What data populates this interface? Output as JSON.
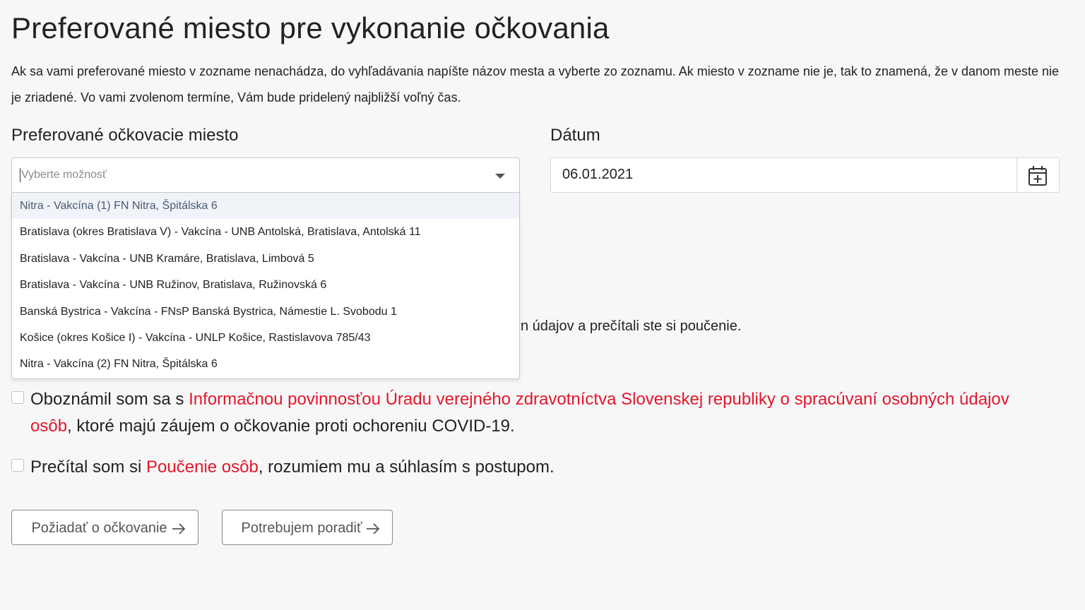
{
  "page": {
    "title": "Preferované miesto pre vykonanie očkovania",
    "intro": "Ak sa vami preferované miesto v zozname nenachádza, do vyhľadávania napíšte názov mesta a vyberte zo zoznamu. Ak miesto v zozname nie je, tak to znamená, že v danom meste nie je zriadené. Vo vami zvolenom termíne, Vám bude pridelený najbližší voľný čas."
  },
  "place": {
    "label": "Preferované očkovacie miesto",
    "placeholder": "Vyberte možnosť",
    "options": [
      "Nitra - Vakcína (1) FN Nitra, Špitálska 6",
      "Bratislava (okres Bratislava V) - Vakcína - UNB Antolská, Bratislava, Antolská 11",
      "Bratislava - Vakcína - UNB Kramáre, Bratislava, Limbová 5",
      "Bratislava - Vakcína - UNB Ružinov, Bratislava, Ružinovská 6",
      "Banská Bystrica - Vakcína - FNsP Banská Bystrica, Námestie L. Svobodu 1",
      "Košice (okres Košice I) - Vakcína - UNLP Košice, Rastislavova 785/43",
      "Nitra - Vakcína (2) FN Nitra, Špitálska 6"
    ]
  },
  "date": {
    "label": "Dátum",
    "value": "06.01.2021",
    "icon": "calendar-plus-icon"
  },
  "obscured_text": "n údajov a prečítali ste si poučenie.",
  "consent": {
    "info_prefix": "Oboznámil som sa s ",
    "info_link": "Informačnou povinnosťou Úradu verejného zdravotníctva Slovenskej republiky o spracúvaní osobných údajov osôb",
    "info_suffix": ", ktoré majú záujem o očkovanie proti ochoreniu COVID-19.",
    "read_prefix": "Prečítal som si ",
    "read_link": "Poučenie osôb",
    "read_suffix": ", rozumiem mu a súhlasím s postupom."
  },
  "buttons": {
    "request": "Požiadať o očkovanie",
    "advise": "Potrebujem poradiť"
  },
  "colors": {
    "link": "#e4172b",
    "highlight": "#f0f3f8"
  }
}
